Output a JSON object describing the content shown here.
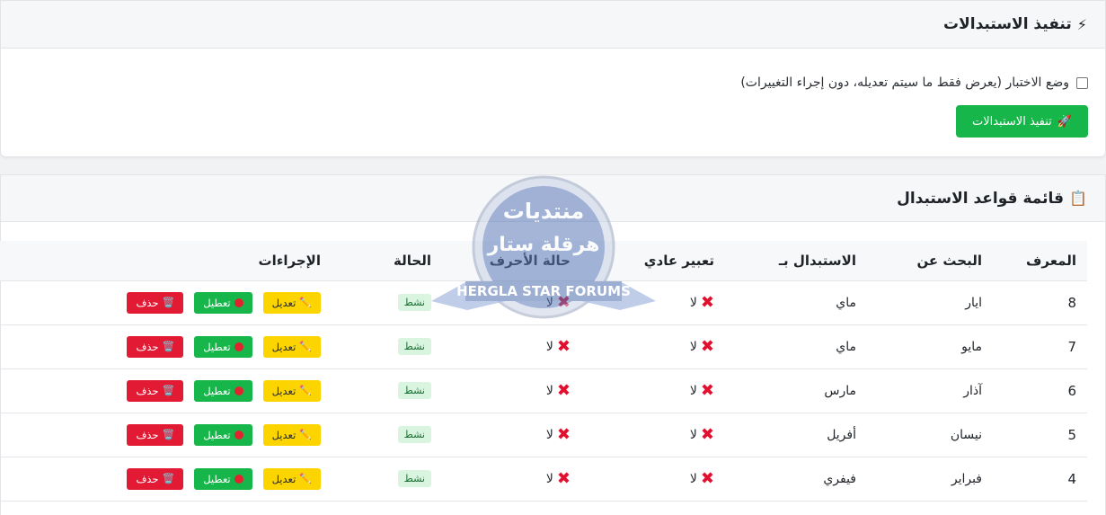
{
  "apply_section": {
    "title": "تنفيذ الاستبدالات",
    "title_icon": "lightning-icon",
    "test_mode_label": "وضع الاختبار (يعرض فقط ما سيتم تعديله، دون إجراء التغييرات)",
    "test_mode_checked": false,
    "run_button_label": "تنفيذ الاستبدالات",
    "run_button_icon": "rocket-icon"
  },
  "rules_section": {
    "title": "قائمة قواعد الاستبدال",
    "title_icon": "clipboard-icon",
    "columns": {
      "id": "المعرف",
      "search": "البحث عن",
      "replace": "الاستبدال بـ",
      "regex": "تعبير عادي",
      "case": "حالة الأحرف",
      "status": "الحالة",
      "actions": "الإجراءات"
    },
    "rows": [
      {
        "id": "8",
        "search": "ايار",
        "replace": "ماي",
        "regex": "لا",
        "case": "لا",
        "status": "نشط"
      },
      {
        "id": "7",
        "search": "مايو",
        "replace": "ماي",
        "regex": "لا",
        "case": "لا",
        "status": "نشط"
      },
      {
        "id": "6",
        "search": "آذار",
        "replace": "مارس",
        "regex": "لا",
        "case": "لا",
        "status": "نشط"
      },
      {
        "id": "5",
        "search": "نيسان",
        "replace": "أفريل",
        "regex": "لا",
        "case": "لا",
        "status": "نشط"
      },
      {
        "id": "4",
        "search": "فبراير",
        "replace": "فيفري",
        "regex": "لا",
        "case": "لا",
        "status": "نشط"
      }
    ],
    "actions": {
      "edit": "تعديل",
      "disable": "تعطيل",
      "delete": "حذف"
    }
  },
  "watermark": {
    "line1": "منتديات",
    "line2": "هرقلة ستار",
    "banner": "HERGLA STAR FORUMS"
  },
  "colors": {
    "run_button": "#17b64b",
    "edit_button": "#fcd500",
    "disable_button": "#17b64b",
    "delete_button": "#e21a34",
    "status_badge_bg": "#d9f4df"
  }
}
